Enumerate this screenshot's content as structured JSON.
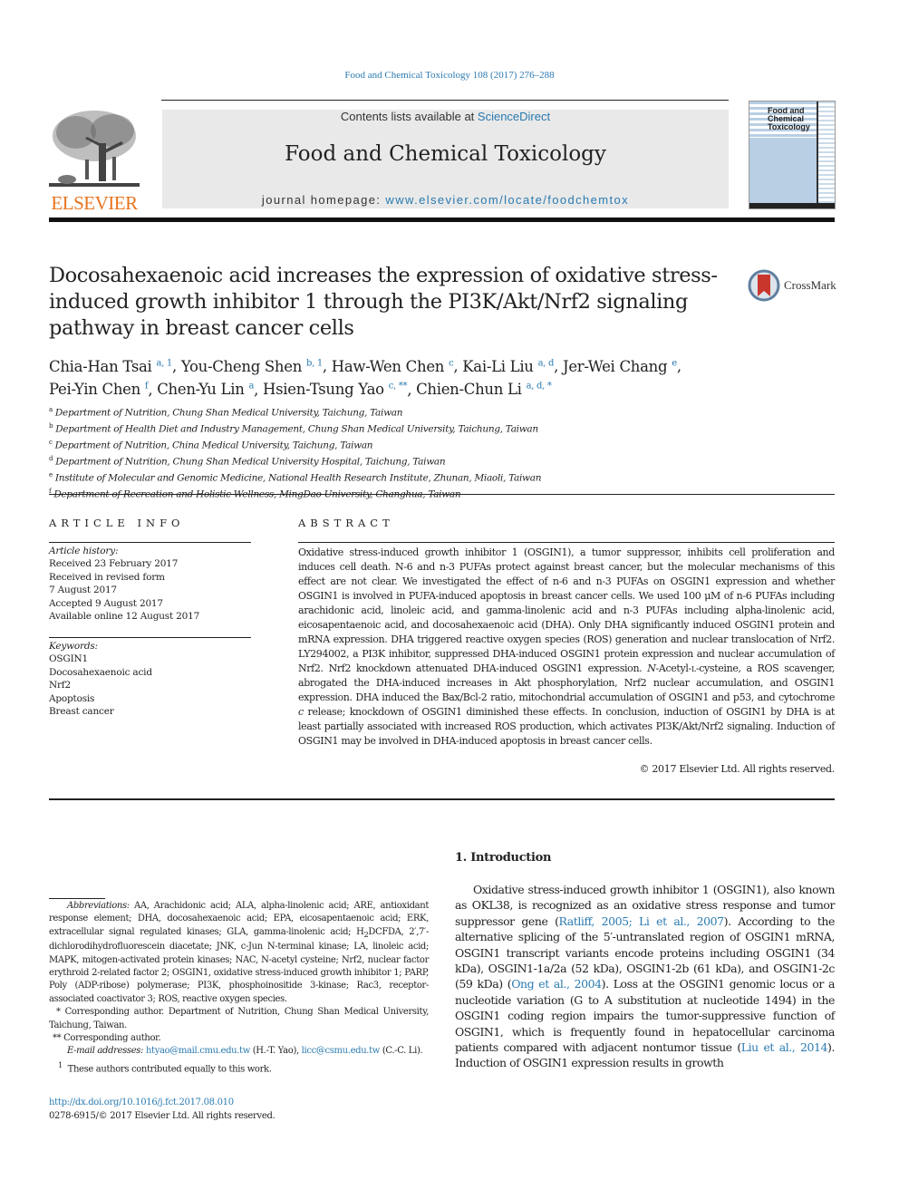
{
  "header": {
    "journal_ref": "Food and Chemical Toxicology 108 (2017) 276–288",
    "publisher_logo_text": "ELSEVIER",
    "contents_prefix": "Contents lists available at ",
    "contents_link": "ScienceDirect",
    "journal_title": "Food and Chemical Toxicology",
    "homepage_prefix": "journal homepage: ",
    "homepage_link": "www.elsevier.com/locate/foodchemtox",
    "cover_title_lines": [
      "Food and",
      "Chemical",
      "Toxicology"
    ]
  },
  "article": {
    "title": "Docosahexaenoic acid increases the expression of oxidative stress-induced growth inhibitor 1 through the PI3K/Akt/Nrf2 signaling pathway in breast cancer cells",
    "crossmark_label": "CrossMark",
    "authors": [
      {
        "name": "Chia-Han Tsai",
        "marks": "a, 1"
      },
      {
        "name": "You-Cheng Shen",
        "marks": "b, 1"
      },
      {
        "name": "Haw-Wen Chen",
        "marks": "c"
      },
      {
        "name": "Kai-Li Liu",
        "marks": "a, d"
      },
      {
        "name": "Jer-Wei Chang",
        "marks": "e"
      },
      {
        "name": "Pei-Yin Chen",
        "marks": "f"
      },
      {
        "name": "Chen-Yu Lin",
        "marks": "a"
      },
      {
        "name": "Hsien-Tsung Yao",
        "marks": "c, **"
      },
      {
        "name": "Chien-Chun Li",
        "marks": "a, d, *"
      }
    ],
    "affiliations": [
      {
        "mark": "a",
        "text": "Department of Nutrition, Chung Shan Medical University, Taichung, Taiwan"
      },
      {
        "mark": "b",
        "text": "Department of Health Diet and Industry Management, Chung Shan Medical University, Taichung, Taiwan"
      },
      {
        "mark": "c",
        "text": "Department of Nutrition, China Medical University, Taichung, Taiwan"
      },
      {
        "mark": "d",
        "text": "Department of Nutrition, Chung Shan Medical University Hospital, Taichung, Taiwan"
      },
      {
        "mark": "e",
        "text": "Institute of Molecular and Genomic Medicine, National Health Research Institute, Zhunan, Miaoli, Taiwan"
      },
      {
        "mark": "f",
        "text": "Department of Recreation and Holistic Wellness, MingDao University, Changhua, Taiwan"
      }
    ]
  },
  "article_info": {
    "heading": "ARTICLE INFO",
    "history_label": "Article history:",
    "history": [
      "Received 23 February 2017",
      "Received in revised form",
      "7 August 2017",
      "Accepted 9 August 2017",
      "Available online 12 August 2017"
    ],
    "keywords_label": "Keywords:",
    "keywords": [
      "OSGIN1",
      "Docosahexaenoic acid",
      "Nrf2",
      "Apoptosis",
      "Breast cancer"
    ]
  },
  "abstract": {
    "heading": "ABSTRACT",
    "text_part1": "Oxidative stress-induced growth inhibitor 1 (OSGIN1), a tumor suppressor, inhibits cell proliferation and induces cell death. N-6 and n-3 PUFAs protect against breast cancer, but the molecular mechanisms of this effect are not clear. We investigated the effect of n-6 and n-3 PUFAs on OSGIN1 expression and whether OSGIN1 is involved in PUFA-induced apoptosis in breast cancer cells. We used 100 μM of n-6 PUFAs including arachidonic acid, linoleic acid, and gamma-linolenic acid and n-3 PUFAs including alpha-linolenic acid, eicosapentaenoic acid, and docosahexaenoic acid (DHA). Only DHA significantly induced OSGIN1 protein and mRNA expression. DHA triggered reactive oxygen species (ROS) generation and nuclear translocation of Nrf2. LY294002, a PI3K inhibitor, suppressed DHA-induced OSGIN1 protein expression and nuclear accumulation of Nrf2. Nrf2 knockdown attenuated DHA-induced OSGIN1 expression. ",
    "text_italic1": "N",
    "text_part2": "-Acetyl-",
    "text_smallcaps": "l",
    "text_part3": "-cysteine, a ROS scavenger, abrogated the DHA-induced increases in Akt phosphorylation, Nrf2 nuclear accumulation, and OSGIN1 expression. DHA induced the Bax/Bcl-2 ratio, mitochondrial accumulation of OSGIN1 and p53, and cytochrome ",
    "text_italic2": "c",
    "text_part4": " release; knockdown of OSGIN1 diminished these effects. In conclusion, induction of OSGIN1 by DHA is at least partially associated with increased ROS production, which activates PI3K/Akt/Nrf2 signaling. Induction of OSGIN1 may be involved in DHA-induced apoptosis in breast cancer cells.",
    "copyright": "© 2017 Elsevier Ltd. All rights reserved."
  },
  "footnotes": {
    "abbrev_label": "Abbreviations:",
    "abbrev_text_1": " AA, Arachidonic acid; ALA, alpha-linolenic acid; ARE, antioxidant response element; DHA, docosahexaenoic acid; EPA, eicosapentaenoic acid; ERK, extracellular signal regulated kinases; GLA, gamma-linolenic acid; H",
    "abbrev_sub": "2",
    "abbrev_text_2": "DCFDA, 2′,7′-dichlorodihydrofluorescein diacetate; JNK, c-Jun N-terminal kinase; LA, linoleic acid; MAPK, mitogen-activated protein kinases; NAC, N-acetyl cysteine; Nrf2, nuclear factor erythroid 2-related factor 2; OSGIN1, oxidative stress-induced growth inhibitor 1; PARP, Poly (ADP-ribose) polymerase; PI3K, phosphoinositide 3-kinase; Rac3, receptor-associated coactivator 3; ROS, reactive oxygen species.",
    "corresponding_1": "* Corresponding author. Department of Nutrition, Chung Shan Medical University, Taichung, Taiwan.",
    "corresponding_2": "** Corresponding author.",
    "email_label": "E-mail addresses:",
    "email_1": "htyao@mail.cmu.edu.tw",
    "email_1_owner": " (H.-T. Yao), ",
    "email_2": "licc@csmu.edu.tw",
    "email_2_owner": " (C.-C. Li).",
    "equal_contrib_mark": "1",
    "equal_contrib": "These authors contributed equally to this work.",
    "doi": "http://dx.doi.org/10.1016/j.fct.2017.08.010",
    "issn": "0278-6915/© 2017 Elsevier Ltd. All rights reserved."
  },
  "introduction": {
    "heading": "1.  Introduction",
    "p1": "Oxidative stress-induced growth inhibitor 1 (OSGIN1), also known as OKL38, is recognized as an oxidative stress response and tumor suppressor gene (",
    "cite1": "Ratliff, 2005; Li et al., 2007",
    "p2": "). According to the alternative splicing of the 5′-untranslated region of OSGIN1 mRNA, OSGIN1 transcript variants encode proteins including OSGIN1 (34 kDa), OSGIN1-1a/2a (52 kDa), OSGIN1-2b (61 kDa), and OSGIN1-2c (59 kDa) (",
    "cite2": "Ong et al., 2004",
    "p3": "). Loss at the OSGIN1 genomic locus or a nucleotide variation (G to A substitution at nucleotide 1494) in the OSGIN1 coding region impairs the tumor-suppressive function of OSGIN1, which is frequently found in hepatocellular carcinoma patients compared with adjacent nontumor tissue (",
    "cite3": "Liu et al., 2014",
    "p4": "). Induction of OSGIN1 expression results in growth"
  },
  "colors": {
    "link": "#2a7ab0",
    "elsevier_orange": "#e8731c",
    "banner_bg": "#e9e9e9",
    "cover_blue": "#b8cfe4",
    "crossmark_red": "#c9372c"
  }
}
